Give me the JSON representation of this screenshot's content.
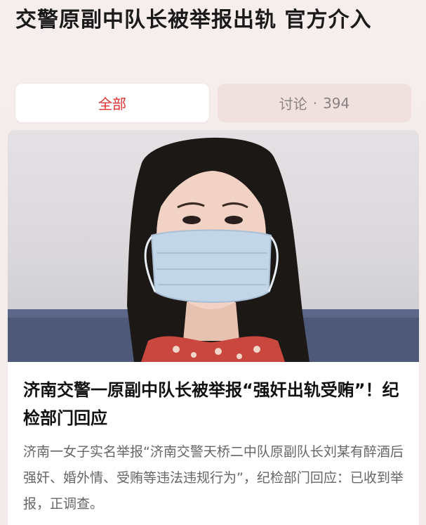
{
  "topic": {
    "title": "交警原副中队长被举报出轨 官方介入"
  },
  "tabs": {
    "all_label": "全部",
    "discussion_label": "讨论",
    "discussion_sep": "·",
    "discussion_count": "394"
  },
  "article": {
    "image_icon": "woman-with-face-mask-photo",
    "title": "济南交警一原副中队长被举报“强奸出轨受贿”！纪检部门回应",
    "summary": "济南一女子实名举报“济南交警天桥二中队原副队长刘某有醉酒后强奸、婚外情、受贿等违法违规行为”，纪检部门回应：已收到举报，正调查。"
  },
  "colors": {
    "accent": "#e0312f",
    "background": "#f4ecea"
  }
}
